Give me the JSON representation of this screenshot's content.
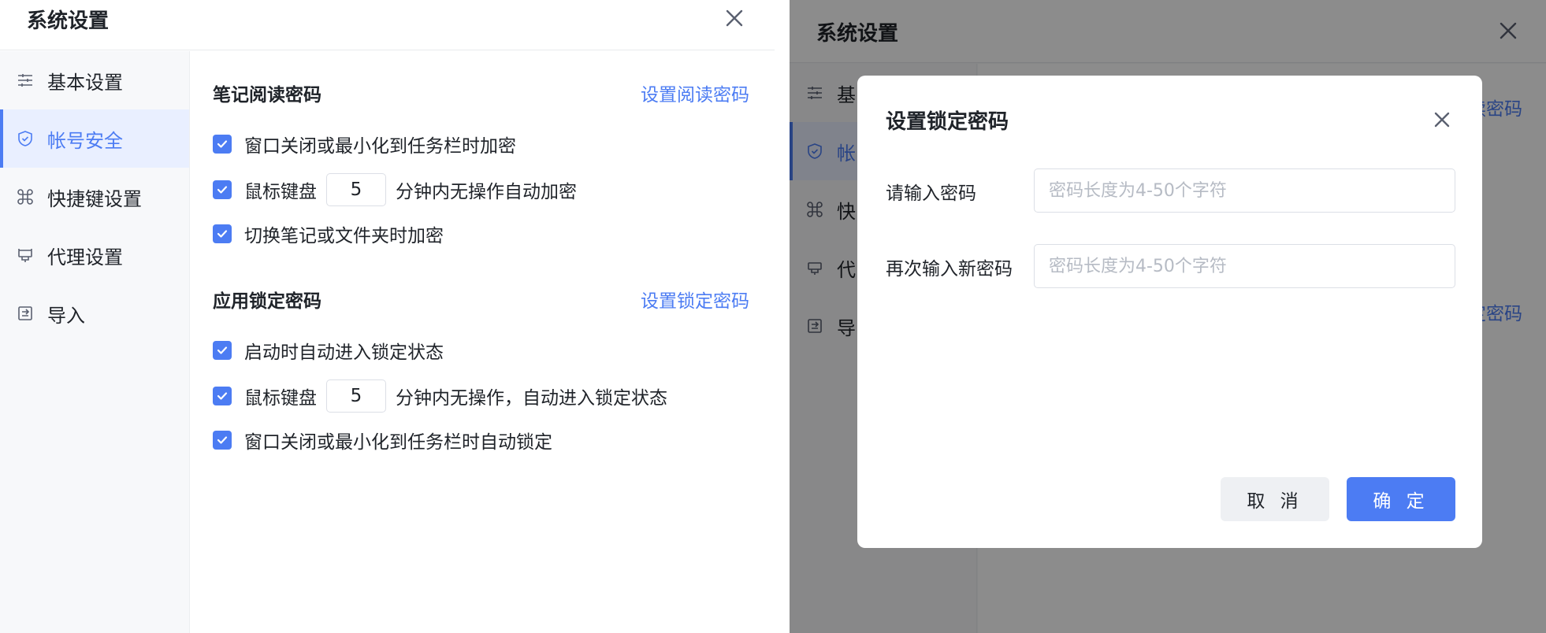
{
  "window": {
    "title": "系统设置"
  },
  "sidebar": {
    "items": [
      {
        "label": "基本设置",
        "icon": "sliders-icon"
      },
      {
        "label": "帐号安全",
        "icon": "shield-icon"
      },
      {
        "label": "快捷键设置",
        "icon": "command-icon"
      },
      {
        "label": "代理设置",
        "icon": "plug-icon"
      },
      {
        "label": "导入",
        "icon": "import-icon"
      }
    ],
    "active_index": 1
  },
  "sections": [
    {
      "title": "笔记阅读密码",
      "action": "设置阅读密码",
      "options": [
        {
          "type": "check",
          "checked": true,
          "label": "窗口关闭或最小化到任务栏时加密"
        },
        {
          "type": "check-input",
          "checked": true,
          "prefix": "鼠标键盘",
          "value": "5",
          "suffix": "分钟内无操作自动加密"
        },
        {
          "type": "check",
          "checked": true,
          "label": "切换笔记或文件夹时加密"
        }
      ]
    },
    {
      "title": "应用锁定密码",
      "action": "设置锁定密码",
      "options": [
        {
          "type": "check",
          "checked": true,
          "label": "启动时自动进入锁定状态"
        },
        {
          "type": "check-input",
          "checked": true,
          "prefix": "鼠标键盘",
          "value": "5",
          "suffix": "分钟内无操作，自动进入锁定状态"
        },
        {
          "type": "check",
          "checked": true,
          "label": "窗口关闭或最小化到任务栏时自动锁定"
        }
      ]
    }
  ],
  "right_window": {
    "sidebar_partial": [
      "基",
      "帐",
      "快",
      "代",
      "导"
    ],
    "link_partial_1": "读密码",
    "link_partial_2": "定密码"
  },
  "modal": {
    "title": "设置锁定密码",
    "fields": [
      {
        "label": "请输入密码",
        "placeholder": "密码长度为4-50个字符",
        "value": ""
      },
      {
        "label": "再次输入新密码",
        "placeholder": "密码长度为4-50个字符",
        "value": ""
      }
    ],
    "cancel_label": "取 消",
    "ok_label": "确 定"
  },
  "colors": {
    "accent": "#4c7cf3",
    "active_bg": "#e9efff",
    "sidebar_bg": "#f7f8fa",
    "overlay": "rgba(0,0,0,0.45)"
  }
}
